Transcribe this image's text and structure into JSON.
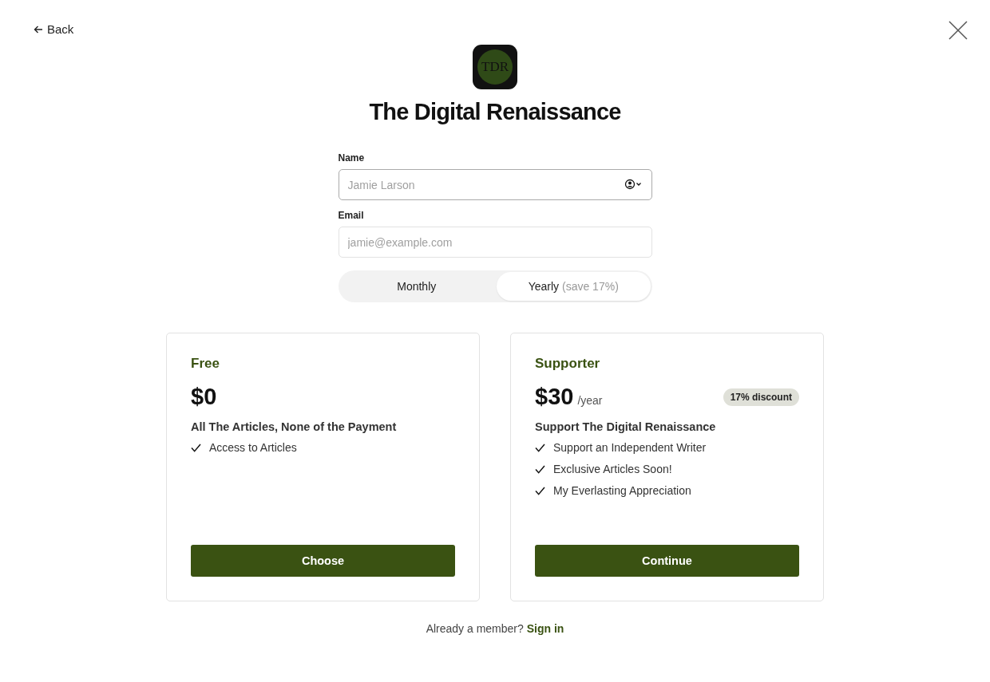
{
  "nav": {
    "back": "Back"
  },
  "brand": {
    "logo_text": "TDR",
    "title": "The Digital Renaissance"
  },
  "form": {
    "fields": [
      {
        "label": "Name",
        "placeholder": "Jamie Larson",
        "focused": true,
        "autofill_icon": true
      },
      {
        "label": "Email",
        "placeholder": "jamie@example.com",
        "focused": false,
        "autofill_icon": false
      }
    ]
  },
  "billing_toggle": [
    {
      "label": "Monthly",
      "selected": false
    },
    {
      "label": "Yearly",
      "note": "(save 17%)",
      "selected": true
    }
  ],
  "plans": [
    {
      "name": "Free",
      "price": "$0",
      "tagline": "All The Articles, None of the Payment",
      "features": [
        "Access to Articles"
      ],
      "button": "Choose"
    },
    {
      "name": "Supporter",
      "price": "$30",
      "period": "/year",
      "badge": "17% discount",
      "tagline": "Support The Digital Renaissance",
      "features": [
        "Support an Independent Writer",
        "Exclusive Articles Soon!",
        "My Everlasting Appreciation"
      ],
      "button": "Continue"
    }
  ],
  "footer": {
    "text": "Already a member?",
    "link": "Sign in"
  }
}
